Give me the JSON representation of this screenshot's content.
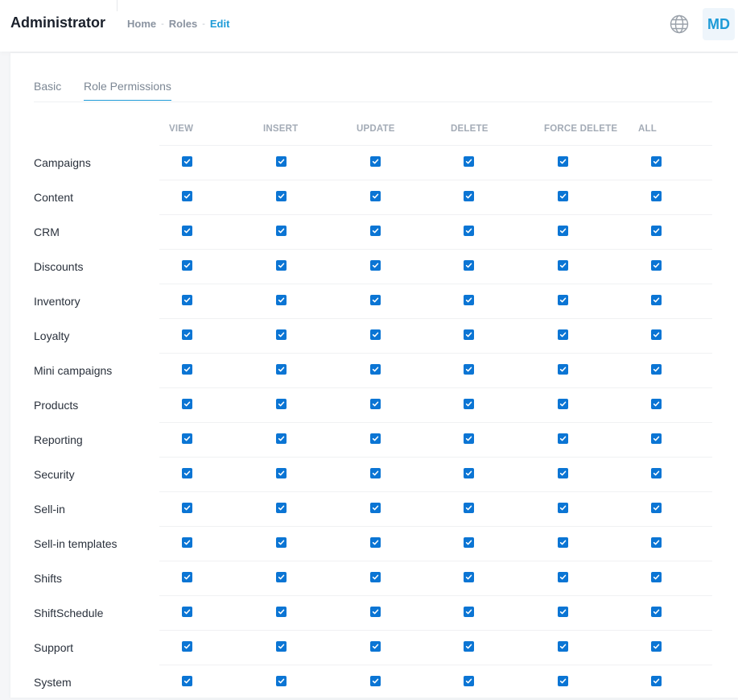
{
  "header": {
    "title": "Administrator",
    "breadcrumb": [
      {
        "label": "Home"
      },
      {
        "label": "Roles"
      },
      {
        "label": "Edit"
      }
    ],
    "separator": "-",
    "language_icon": "globe-icon",
    "avatar_initials": "MD"
  },
  "tabs": [
    {
      "label": "Basic",
      "active": false
    },
    {
      "label": "Role Permissions",
      "active": true
    }
  ],
  "columns": [
    "VIEW",
    "INSERT",
    "UPDATE",
    "DELETE",
    "FORCE DELETE",
    "ALL"
  ],
  "rows": [
    {
      "label": "Campaigns",
      "checked": [
        true,
        true,
        true,
        true,
        true,
        true
      ]
    },
    {
      "label": "Content",
      "checked": [
        true,
        true,
        true,
        true,
        true,
        true
      ]
    },
    {
      "label": "CRM",
      "checked": [
        true,
        true,
        true,
        true,
        true,
        true
      ]
    },
    {
      "label": "Discounts",
      "checked": [
        true,
        true,
        true,
        true,
        true,
        true
      ]
    },
    {
      "label": "Inventory",
      "checked": [
        true,
        true,
        true,
        true,
        true,
        true
      ]
    },
    {
      "label": "Loyalty",
      "checked": [
        true,
        true,
        true,
        true,
        true,
        true
      ]
    },
    {
      "label": "Mini campaigns",
      "checked": [
        true,
        true,
        true,
        true,
        true,
        true
      ]
    },
    {
      "label": "Products",
      "checked": [
        true,
        true,
        true,
        true,
        true,
        true
      ]
    },
    {
      "label": "Reporting",
      "checked": [
        true,
        true,
        true,
        true,
        true,
        true
      ]
    },
    {
      "label": "Security",
      "checked": [
        true,
        true,
        true,
        true,
        true,
        true
      ]
    },
    {
      "label": "Sell-in",
      "checked": [
        true,
        true,
        true,
        true,
        true,
        true
      ]
    },
    {
      "label": "Sell-in templates",
      "checked": [
        true,
        true,
        true,
        true,
        true,
        true
      ]
    },
    {
      "label": "Shifts",
      "checked": [
        true,
        true,
        true,
        true,
        true,
        true
      ]
    },
    {
      "label": "ShiftSchedule",
      "checked": [
        true,
        true,
        true,
        true,
        true,
        true
      ]
    },
    {
      "label": "Support",
      "checked": [
        true,
        true,
        true,
        true,
        true,
        true
      ]
    },
    {
      "label": "System",
      "checked": [
        true,
        true,
        true,
        true,
        true,
        true
      ]
    }
  ],
  "colors": {
    "accent": "#1e9bd7",
    "checkbox": "#0b75d4"
  }
}
